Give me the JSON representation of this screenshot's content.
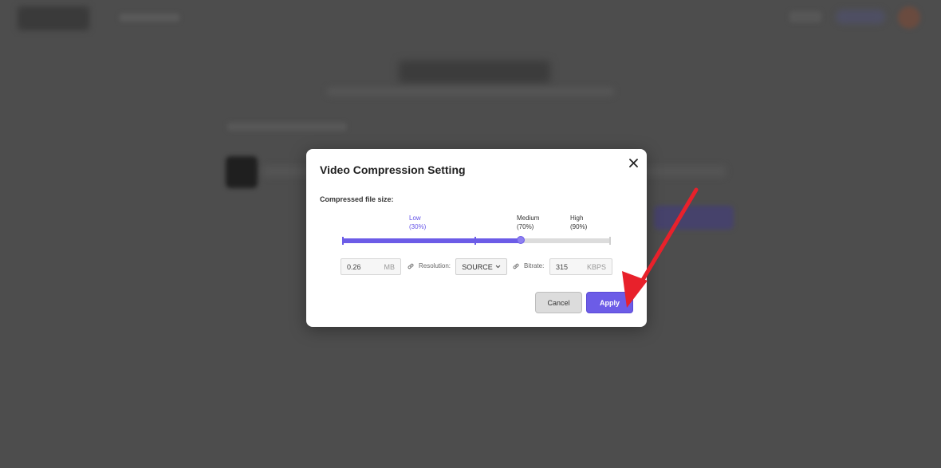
{
  "dialog": {
    "title": "Video Compression Setting",
    "section_label": "Compressed file size:",
    "slider": {
      "ticks": [
        {
          "label": "Low",
          "percent": "(30%)",
          "active": true
        },
        {
          "label": "Medium",
          "percent": "(70%)",
          "active": false
        },
        {
          "label": "High",
          "percent": "(90%)",
          "active": false
        }
      ],
      "value_fraction": 0.665
    },
    "size": {
      "value": "0.26",
      "unit": "MB"
    },
    "resolution": {
      "label": "Resolution:",
      "value": "SOURCE"
    },
    "bitrate": {
      "label": "Bitrate:",
      "value": "315",
      "unit": "KBPS"
    },
    "cancel_label": "Cancel",
    "apply_label": "Apply"
  },
  "colors": {
    "accent": "#6c5ce7",
    "annotation_arrow": "#e8212b",
    "overlay": "#4b4b4b"
  },
  "icons": {
    "close": "close-icon",
    "link": "link-icon",
    "dropdown": "chevron-down-icon"
  }
}
